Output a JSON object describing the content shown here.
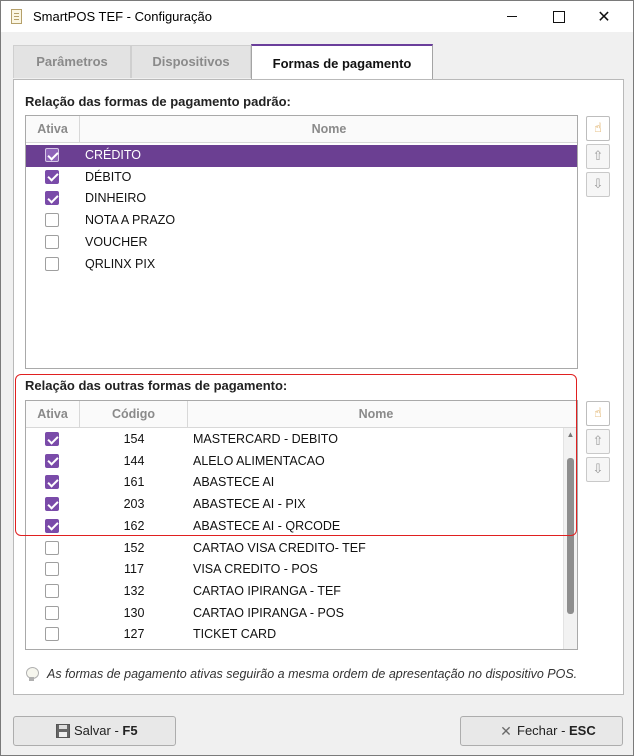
{
  "window": {
    "title": "SmartPOS TEF - Configuração",
    "minimize_glyph": "—",
    "maximize_glyph": "☐",
    "close_glyph": "✕"
  },
  "tabs": [
    {
      "label": "Parâmetros"
    },
    {
      "label": "Dispositivos"
    },
    {
      "label": "Formas de pagamento",
      "active": true
    }
  ],
  "default_payments": {
    "section_label": "Relação das formas de pagamento padrão:",
    "columns": {
      "active": "Ativa",
      "name": "Nome"
    },
    "rows": [
      {
        "active": true,
        "name": "CRÉDITO",
        "selected": true
      },
      {
        "active": true,
        "name": "DÉBITO"
      },
      {
        "active": true,
        "name": "DINHEIRO"
      },
      {
        "active": false,
        "name": "NOTA A PRAZO"
      },
      {
        "active": false,
        "name": "VOUCHER"
      },
      {
        "active": false,
        "name": "QRLINX PIX"
      }
    ]
  },
  "other_payments": {
    "section_label": "Relação das outras formas de pagamento:",
    "columns": {
      "active": "Ativa",
      "code": "Código",
      "name": "Nome"
    },
    "rows": [
      {
        "active": true,
        "code": "154",
        "name": "MASTERCARD - DEBITO"
      },
      {
        "active": true,
        "code": "144",
        "name": "ALELO ALIMENTACAO"
      },
      {
        "active": true,
        "code": "161",
        "name": "ABASTECE AI"
      },
      {
        "active": true,
        "code": "203",
        "name": "ABASTECE AI - PIX"
      },
      {
        "active": true,
        "code": "162",
        "name": "ABASTECE AI - QRCODE"
      },
      {
        "active": false,
        "code": "152",
        "name": "CARTAO VISA CREDITO- TEF"
      },
      {
        "active": false,
        "code": "117",
        "name": "VISA CREDITO - POS"
      },
      {
        "active": false,
        "code": "132",
        "name": "CARTAO IPIRANGA - TEF"
      },
      {
        "active": false,
        "code": "130",
        "name": "CARTAO IPIRANGA - POS"
      },
      {
        "active": false,
        "code": "127",
        "name": "TICKET CARD"
      }
    ]
  },
  "side_buttons": {
    "hand_glyph": "☝",
    "up_glyph": "⇧",
    "down_glyph": "⇩"
  },
  "footer_note": "As formas de pagamento ativas seguirão a mesma ordem de apresentação no dispositivo POS.",
  "buttons": {
    "save_label": "Salvar - ",
    "save_key": "F5",
    "close_label": "Fechar - ",
    "close_key": "ESC"
  },
  "colors": {
    "accent": "#6b3f92",
    "highlight_border": "#e02020"
  }
}
